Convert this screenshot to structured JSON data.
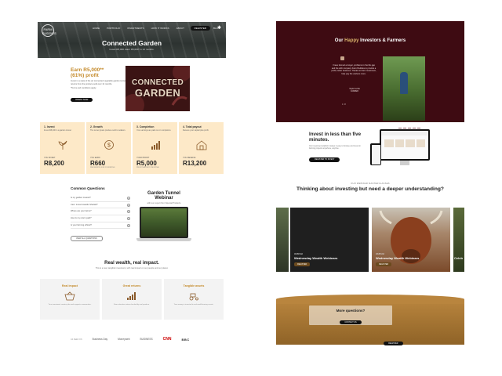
{
  "brand": {
    "logo_text": "FARM BUDDIES"
  },
  "nav": {
    "items": [
      "HOME",
      "PORTFOLIO",
      "INVESTMENTS",
      "HOW IT WORKS",
      "ABOUT",
      "RESOURCES",
      "BLOG"
    ],
    "cta": "REGISTER"
  },
  "hero": {
    "title": "Connected Garden",
    "subtitle": "Invest R5,000. Earn R5,000* in 12 months."
  },
  "earn": {
    "heading_line1": "Earn R5,000**",
    "heading_line2": "(61%) profit",
    "desc": "Invest in a state of the art connected vegetable garden tunnel and get returns from the produce sold over 12 months.",
    "note": "*Terms and conditions apply.",
    "cta": "INVEST NOW"
  },
  "cg_card": {
    "line1": "CONNECTED",
    "line2": "GARDEN"
  },
  "steps": [
    {
      "title": "1. Invest",
      "desc": "Invest R8,200 in a garden tunnel.",
      "label": "YOU INVEST",
      "value": "R8,200",
      "caption": "",
      "icon": "plant-icon"
    },
    {
      "title": "2. Growth",
      "desc": "The tunnel grows produce sold to retailers.",
      "label": "YOU EARN",
      "value": "R660",
      "caption": "PER MONTH FOR 12 MONTHS",
      "icon": "money-icon"
    },
    {
      "title": "3. Completion",
      "desc": "Your earnings are paid out on completion.",
      "label": "YOUR PROFIT",
      "value": "R5,000",
      "caption": "PROFIT AFTER 12 MONTHS",
      "icon": "growth-chart-icon"
    },
    {
      "title": "4. Total payout",
      "desc": "Receive your capital plus profit.",
      "label": "YOU RECEIVE",
      "value": "R13,200",
      "caption": "",
      "icon": "barn-icon"
    }
  ],
  "faq": {
    "title": "Common Questions",
    "questions": [
      "Is my garden insured?",
      "Can I invest towards Shariah?",
      "Where are your farms?",
      "How is my return paid?",
      "Is your farming ethical?"
    ],
    "more_label": "VIEW ALL QUESTIONS"
  },
  "webinar": {
    "title_line1": "Garden Tunnel",
    "title_line2": "Webinar",
    "subtitle": "with our expert from Special Products"
  },
  "real_wealth": {
    "title": "Real wealth, real impact.",
    "desc": "This is a real, tangible investment, with real impact on our people and our planet."
  },
  "tiles": [
    {
      "title": "Real impact",
      "desc": "Your investment creates jobs and supports communities.",
      "icon": "basket-icon"
    },
    {
      "title": "Great returns",
      "desc": "Earn attractive returns backed by real produce.",
      "icon": "bar-chart-icon"
    },
    {
      "title": "Tangible assets",
      "desc": "Your money is invested in real-world farming assets.",
      "icon": "tractor-icon"
    }
  ],
  "press": {
    "label": "AS SEEN ON",
    "items": [
      "Business Day",
      "Moneyweb",
      "BUSINESS",
      "CNN",
      "BBC"
    ]
  },
  "testimonials": {
    "title_pre": "Our ",
    "title_highlight": "Happy",
    "title_post": " Investors & Farmers",
    "quote": "I have farmed a longer, problems in the life gap and the with company Farm Buddies to provide a profit, better business. Thanks to their investment, help pay the workers more.",
    "author": "Tayla Cecilia",
    "author_role": "FARMER",
    "pager": "1 / 8"
  },
  "invest_fast": {
    "title": "Invest in less than five minutes.",
    "desc": "Our investment platform makes it easy to browse and invest in farming projects anywhere, anytime.",
    "cta": "REGISTER TO INVEST"
  },
  "masterclasses": {
    "kicker": "OUR WEBINAR MASTERCLASSES",
    "title": "Thinking about investing but need a deeper understanding?"
  },
  "carousel": [
    {
      "label": "WEBINAR",
      "title": "Wednesday Wealth Webinars",
      "cta": "REGISTER"
    },
    {
      "label": "WEBINAR",
      "title": "Wednesday Wealth Webinars",
      "cta": "REGISTER"
    },
    {
      "label": "",
      "title": "Celeb",
      "cta": ""
    }
  ],
  "more_questions": {
    "title": "More questions?",
    "cta": "CONTACT US"
  },
  "register_bar": {
    "text": "Register to start investing",
    "cta": "REGISTER"
  },
  "colors": {
    "burgundy": "#3e0b12",
    "gold": "#c48a2a",
    "cream": "#fde9c8",
    "dark": "#111111"
  }
}
